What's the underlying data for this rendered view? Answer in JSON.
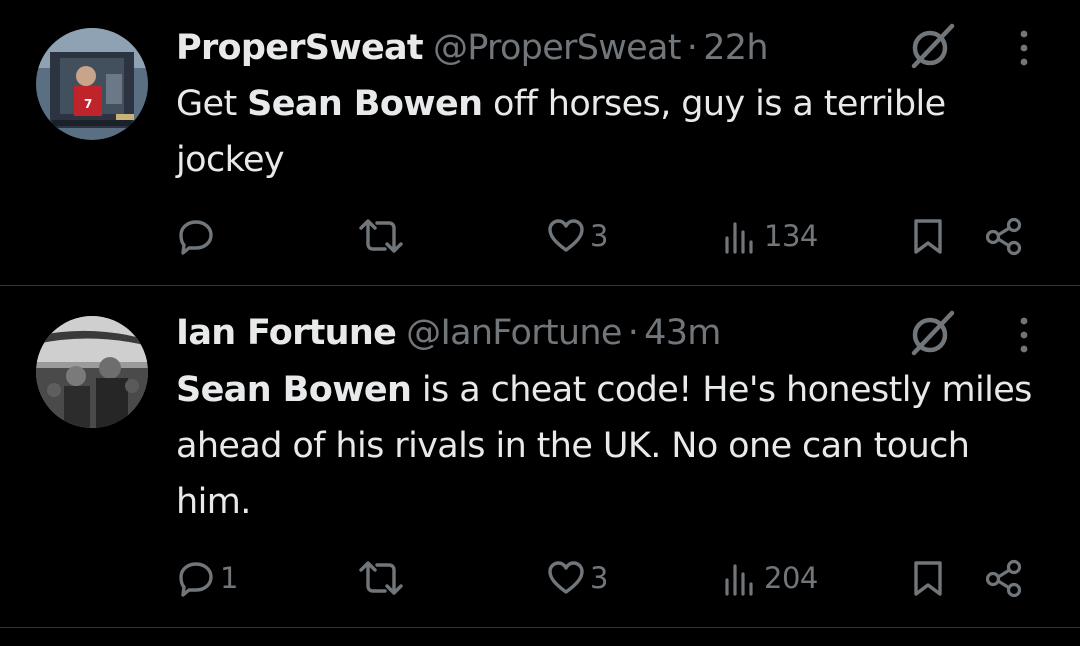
{
  "tweets": [
    {
      "display_name": "ProperSweat",
      "handle": "@ProperSweat",
      "separator": "·",
      "time": "22h",
      "text_parts": [
        "Get ",
        "Sean Bowen",
        " off horses, guy is a terrible jockey"
      ],
      "bold_parts": [
        1
      ],
      "replies": "",
      "retweets": "",
      "likes": "3",
      "views": "134"
    },
    {
      "display_name": "Ian Fortune",
      "handle": "@IanFortune",
      "separator": "·",
      "time": "43m",
      "text_parts": [
        "Sean Bowen",
        " is a cheat code! He's honestly miles ahead of his rivals in the UK. No one can touch him."
      ],
      "bold_parts": [
        0
      ],
      "replies": "1",
      "retweets": "",
      "likes": "3",
      "views": "204"
    }
  ],
  "icons": {
    "grok": "grok-icon",
    "more": "more-vertical-icon",
    "reply": "reply-icon",
    "retweet": "retweet-icon",
    "like": "heart-icon",
    "views": "views-icon",
    "bookmark": "bookmark-icon",
    "share": "share-icon"
  },
  "colors": {
    "background": "#000000",
    "text_primary": "#e7e9ea",
    "text_secondary": "#71767b",
    "divider": "#2f3336"
  }
}
